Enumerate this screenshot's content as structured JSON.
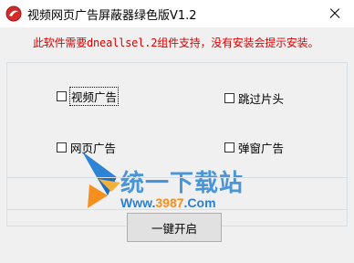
{
  "window": {
    "title": "视频网页广告屏蔽器绿色版V1.2",
    "close_icon": "close-icon"
  },
  "notice": "此软件需要dneallsel.2组件支持，没有安装会提示安装。",
  "options": [
    {
      "label": "视频广告",
      "checked": false,
      "focused": true
    },
    {
      "label": "跳过片头",
      "checked": false,
      "focused": false
    },
    {
      "label": "网页广告",
      "checked": false,
      "focused": false
    },
    {
      "label": "弹窗广告",
      "checked": false,
      "focused": false
    }
  ],
  "watermark": {
    "brand": "统一下载站",
    "url_prefix": "Www.",
    "url_number": "3987",
    "url_suffix": ".Com"
  },
  "start_button": "一键开启",
  "colors": {
    "notice": "#e00000",
    "watermark_blue": "#3a8fd8",
    "watermark_orange": "#f5901e"
  }
}
